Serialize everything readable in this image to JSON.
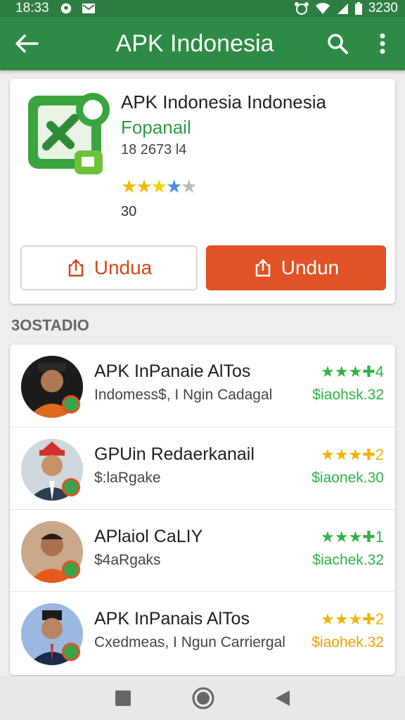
{
  "status_bar": {
    "time": "18:33",
    "right_text": "3230"
  },
  "app_bar": {
    "title": "APK Indonesia"
  },
  "app": {
    "name": "APK Indonesia Indonesia",
    "developer": "Fopanail",
    "meta": "18 2673 l4",
    "rating_count": "30",
    "stars": "★★★★★",
    "button_secondary": "Undua",
    "button_primary": "Undun"
  },
  "section_title": "3OSTADIO",
  "list": [
    {
      "name": "APK InPanaie AlTos",
      "sub": "Indomess$, I Ngin Cadagal",
      "rating": "★★★✚4",
      "rating_color": "#2fb344",
      "price": "$iaohsk.32",
      "price_color": "#2fb344"
    },
    {
      "name": "GPUin Redaerkanail",
      "sub": "$:laRgake",
      "rating": "★★★✚2",
      "rating_color": "#f0b400",
      "price": "$iaonek.30",
      "price_color": "#2fb344"
    },
    {
      "name": "APlaiol CaLIY",
      "sub": "$4aRgaks",
      "rating": "★★★✚1",
      "rating_color": "#2fb344",
      "price": "$iachek.32",
      "price_color": "#2fb344"
    },
    {
      "name": "APK InPanais AlTos",
      "sub": "Cxedmeas, I Ngun Carriergal",
      "rating": "★★★✚2",
      "rating_color": "#f0b400",
      "price": "$iaohek.32",
      "price_color": "#f0a000"
    }
  ],
  "colors": {
    "app_bar": "#2e8b45",
    "accent": "#e15226",
    "developer": "#2e9b3f"
  }
}
